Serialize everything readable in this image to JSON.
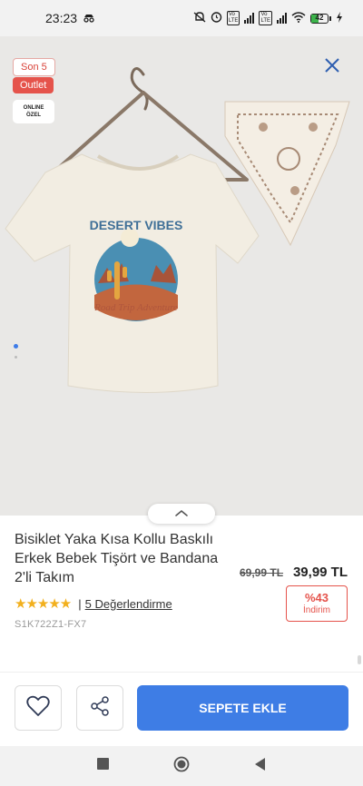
{
  "status_bar": {
    "time": "23:23",
    "battery": "42"
  },
  "badges": {
    "son": "Son 5",
    "outlet": "Outlet",
    "online_line1": "ONLINE",
    "online_line2": "ÖZEL"
  },
  "product": {
    "title": "Bisiklet Yaka Kısa Kollu Baskılı Erkek Bebek Tişört ve Bandana 2'li Takım",
    "price_old": "69,99 TL",
    "price_new": "39,99 TL",
    "discount_pct": "%43",
    "discount_label": "İndirim",
    "rating_stars": 5,
    "reviews_label": "5 Değerlendirme",
    "sku": "S1K722Z1-FX7"
  },
  "print": {
    "headline": "DESERT VIBES",
    "subline": "Road Trip Adventure"
  },
  "actions": {
    "add_to_cart": "SEPETE EKLE"
  },
  "gallery": {
    "total": 2,
    "active": 1
  },
  "colors": {
    "accent": "#3e7de5",
    "sale": "#e5534b",
    "star": "#f2b01e"
  }
}
